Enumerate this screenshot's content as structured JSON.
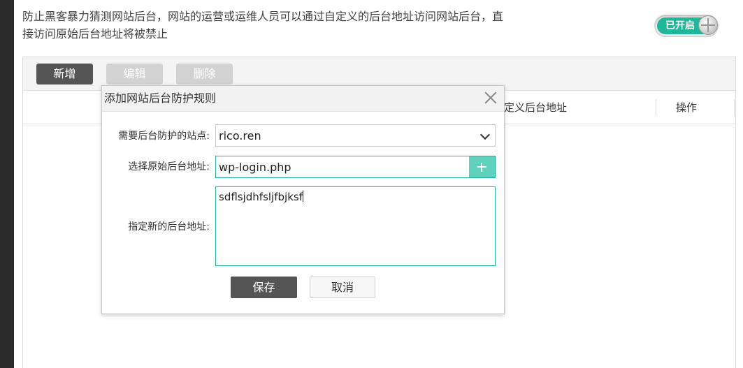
{
  "description": "防止黑客暴力猜测网站后台，网站的运营或运维人员可以通过自定义的后台地址访问网站后台，直接访问原始后台地址将被禁止",
  "toggle": {
    "label": "已开启",
    "state": "on",
    "accent": "#1fb79a"
  },
  "toolbar": {
    "add_label": "新增",
    "edit_label": "编辑",
    "delete_label": "删除"
  },
  "table": {
    "columns": [
      "定义后台地址",
      "操作"
    ]
  },
  "dialog": {
    "title": "添加网站后台防护规则",
    "site_label": "需要后台防护的站点:",
    "site_value": "rico.ren",
    "orig_label": "选择原始后台地址:",
    "orig_value": "wp-login.php",
    "new_label": "指定新的后台地址:",
    "new_value": "sdflsjdhfsljfbjksf",
    "save_label": "保存",
    "cancel_label": "取消"
  }
}
